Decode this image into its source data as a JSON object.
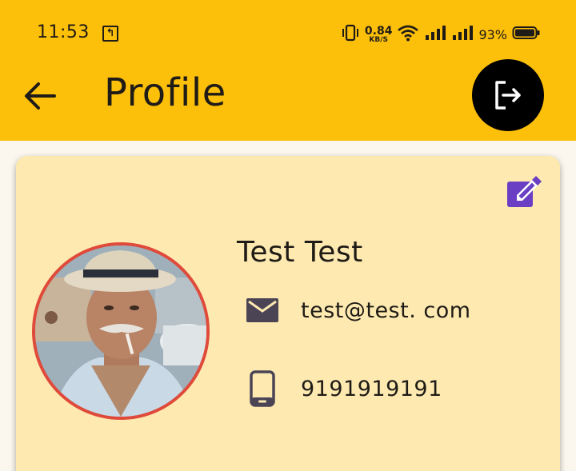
{
  "status_bar": {
    "time": "11:53",
    "notification_glyph": "↰",
    "net_speed_value": "0.84",
    "net_speed_unit": "KB/S",
    "battery_percent": "93%",
    "icons": [
      "vibrate-icon",
      "wifi-icon",
      "signal-icon",
      "signal-icon",
      "battery-icon"
    ]
  },
  "app_bar": {
    "title": "Profile",
    "back_icon": "arrow-left-icon",
    "logout_icon": "logout-icon"
  },
  "profile": {
    "name": "Test Test",
    "email": "test@test. com",
    "phone": "9191919191",
    "email_icon": "mail-icon",
    "phone_icon": "phone-icon",
    "edit_icon": "edit-icon"
  },
  "colors": {
    "app_bar": "#fcbf0a",
    "card": "#feeab1",
    "avatar_border": "#e04a3a",
    "edit_icon": "#6a3fc4",
    "logout_button": "#000000"
  }
}
